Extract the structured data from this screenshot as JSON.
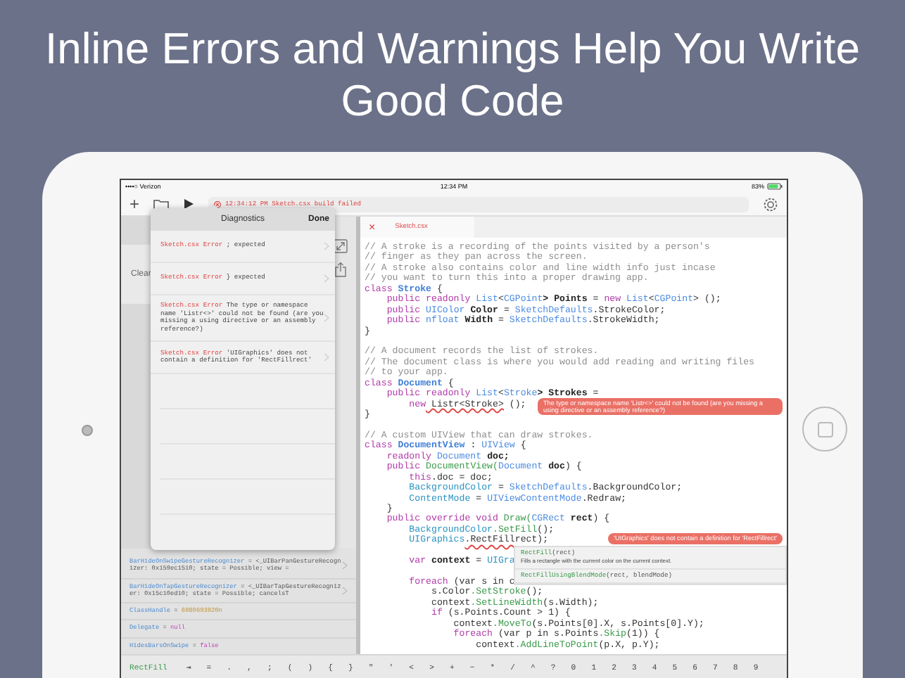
{
  "headline": "Inline Errors and Warnings Help You Write Good Code",
  "status_bar": {
    "carrier": "••••○ Verizon",
    "time": "12:34 PM",
    "battery": "83%"
  },
  "toolbar": {
    "add": "+",
    "build_status": "12:34:12 PM Sketch.csx build failed"
  },
  "left_panel": {
    "clear": "Clear"
  },
  "diagnostics": {
    "title": "Diagnostics",
    "done": "Done",
    "items": [
      {
        "source": "Sketch.csx Error",
        "message": "; expected"
      },
      {
        "source": "Sketch.csx Error",
        "message": "} expected"
      },
      {
        "source": "Sketch.csx Error",
        "message": "The type or namespace name 'Listr<>' could not be found (are you missing a using directive or an assembly reference?)"
      },
      {
        "source": "Sketch.csx Error",
        "message": "'UIGraphics' does not contain a definition for 'RectFillrect'"
      }
    ]
  },
  "debug_items": [
    {
      "name": "BarHideOnSwipeGestureRecognizer",
      "operator": "=",
      "value": "<_UIBarPanGestureRecognizer: 0x159ec1510; state = Possible; view =",
      "kind": "object",
      "expandable": true
    },
    {
      "name": "BarHideOnTapGestureRecognizer",
      "operator": "=",
      "value": "<_UIBarTapGestureRecognizer: 0x15c10ed10; state = Possible; cancelsT",
      "kind": "object",
      "expandable": true
    },
    {
      "name": "ClassHandle",
      "operator": "=",
      "value": "6980693920n",
      "kind": "number",
      "expandable": false
    },
    {
      "name": "Delegate",
      "operator": "=",
      "value": "null",
      "kind": "keyword",
      "expandable": false
    },
    {
      "name": "HidesBarsOnSwipe",
      "operator": "=",
      "value": "false",
      "kind": "keyword",
      "expandable": false
    }
  ],
  "editor": {
    "tab": {
      "close": "×",
      "title": "Sketch.csx"
    },
    "lines": [
      {
        "kind": "code",
        "tokens": [
          {
            "kind": "comment",
            "text": "// A stroke is a recording of the points visited by a person's"
          }
        ]
      },
      {
        "kind": "code",
        "tokens": [
          {
            "kind": "comment",
            "text": "// finger as they pan across the screen."
          }
        ]
      },
      {
        "kind": "code",
        "tokens": [
          {
            "kind": "comment",
            "text": "// A stroke also contains color and line width info just incase"
          }
        ]
      },
      {
        "kind": "code",
        "tokens": [
          {
            "kind": "comment",
            "text": "// you want to turn this into a proper drawing app."
          }
        ]
      },
      {
        "kind": "code",
        "tokens": [
          {
            "kind": "keyword",
            "text": "class"
          },
          {
            "kind": "class",
            "text": " Stroke"
          },
          {
            "kind": "plain",
            "text": " {"
          }
        ]
      },
      {
        "kind": "code",
        "tokens": [
          {
            "kind": "keyword",
            "text": "    public readonly"
          },
          {
            "kind": "type",
            "text": " List"
          },
          {
            "kind": "plain",
            "text": "<"
          },
          {
            "kind": "type",
            "text": "CGPoint"
          },
          {
            "kind": "ident",
            "text": "> Points"
          },
          {
            "kind": "plain",
            "text": " ="
          },
          {
            "kind": "keyword",
            "text": " new"
          },
          {
            "kind": "type",
            "text": " List"
          },
          {
            "kind": "plain",
            "text": "<"
          },
          {
            "kind": "type",
            "text": "CGPoint"
          },
          {
            "kind": "plain",
            "text": "> ();"
          }
        ]
      },
      {
        "kind": "code",
        "tokens": [
          {
            "kind": "keyword",
            "text": "    public"
          },
          {
            "kind": "type",
            "text": " UIColor"
          },
          {
            "kind": "ident",
            "text": " Color"
          },
          {
            "kind": "plain",
            "text": " ="
          },
          {
            "kind": "type",
            "text": " SketchDefaults"
          },
          {
            "kind": "plain",
            "text": ".StrokeColor;"
          }
        ]
      },
      {
        "kind": "code",
        "tokens": [
          {
            "kind": "keyword",
            "text": "    public"
          },
          {
            "kind": "type",
            "text": " nfloat"
          },
          {
            "kind": "ident",
            "text": " Width"
          },
          {
            "kind": "plain",
            "text": " ="
          },
          {
            "kind": "type",
            "text": " SketchDefaults"
          },
          {
            "kind": "plain",
            "text": ".StrokeWidth;"
          }
        ]
      },
      {
        "kind": "code",
        "tokens": [
          {
            "kind": "plain",
            "text": "}"
          }
        ]
      },
      {
        "kind": "blank"
      },
      {
        "kind": "code",
        "tokens": [
          {
            "kind": "comment",
            "text": "// A document records the list of strokes."
          }
        ]
      },
      {
        "kind": "code",
        "tokens": [
          {
            "kind": "comment",
            "text": "// The document class is where you would add reading and writing files"
          }
        ]
      },
      {
        "kind": "code",
        "tokens": [
          {
            "kind": "comment",
            "text": "// to your app."
          }
        ]
      },
      {
        "kind": "code",
        "tokens": [
          {
            "kind": "keyword",
            "text": "class"
          },
          {
            "kind": "class",
            "text": " Document"
          },
          {
            "kind": "plain",
            "text": " {"
          }
        ]
      },
      {
        "kind": "code",
        "tokens": [
          {
            "kind": "keyword",
            "text": "    public readonly"
          },
          {
            "kind": "type",
            "text": " List"
          },
          {
            "kind": "plain",
            "text": "<"
          },
          {
            "kind": "type",
            "text": "Stroke"
          },
          {
            "kind": "ident",
            "text": "> Strokes"
          },
          {
            "kind": "plain",
            "text": " ="
          }
        ]
      },
      {
        "kind": "code",
        "tokens": [
          {
            "kind": "keyword",
            "text": "        new"
          },
          {
            "kind": "error",
            "text": " Listr<Stroke>"
          },
          {
            "kind": "plain",
            "text": " ();"
          }
        ],
        "error": "The type or namespace name 'Listr<>' could not be found (are you missing a using directive or an assembly reference?)"
      },
      {
        "kind": "code",
        "tokens": [
          {
            "kind": "plain",
            "text": "}"
          }
        ]
      },
      {
        "kind": "blank"
      },
      {
        "kind": "code",
        "tokens": [
          {
            "kind": "comment",
            "text": "// A custom UIView that can draw strokes."
          }
        ]
      },
      {
        "kind": "code",
        "tokens": [
          {
            "kind": "keyword",
            "text": "class"
          },
          {
            "kind": "class",
            "text": " DocumentView"
          },
          {
            "kind": "plain",
            "text": " :"
          },
          {
            "kind": "type",
            "text": " UIView"
          },
          {
            "kind": "plain",
            "text": " {"
          }
        ]
      },
      {
        "kind": "code",
        "tokens": [
          {
            "kind": "keyword",
            "text": "    readonly"
          },
          {
            "kind": "type",
            "text": " Document"
          },
          {
            "kind": "ident",
            "text": " doc;"
          }
        ]
      },
      {
        "kind": "code",
        "tokens": [
          {
            "kind": "keyword",
            "text": "    public"
          },
          {
            "kind": "method",
            "text": " DocumentView("
          },
          {
            "kind": "type",
            "text": "Document"
          },
          {
            "kind": "ident",
            "text": " doc"
          },
          {
            "kind": "plain",
            "text": ") {"
          }
        ]
      },
      {
        "kind": "code",
        "tokens": [
          {
            "kind": "keyword",
            "text": "        this"
          },
          {
            "kind": "plain",
            "text": ".doc = doc;"
          }
        ]
      },
      {
        "kind": "code",
        "tokens": [
          {
            "kind": "member",
            "text": "        BackgroundColor"
          },
          {
            "kind": "plain",
            "text": " ="
          },
          {
            "kind": "type",
            "text": " SketchDefaults"
          },
          {
            "kind": "plain",
            "text": ".BackgroundColor;"
          }
        ]
      },
      {
        "kind": "code",
        "tokens": [
          {
            "kind": "member",
            "text": "        ContentMode"
          },
          {
            "kind": "plain",
            "text": " ="
          },
          {
            "kind": "type",
            "text": " UIViewContentMode"
          },
          {
            "kind": "plain",
            "text": ".Redraw;"
          }
        ]
      },
      {
        "kind": "code",
        "tokens": [
          {
            "kind": "plain",
            "text": "    }"
          }
        ]
      },
      {
        "kind": "code",
        "tokens": [
          {
            "kind": "keyword",
            "text": "    public override void"
          },
          {
            "kind": "method",
            "text": " Draw("
          },
          {
            "kind": "type",
            "text": "CGRect"
          },
          {
            "kind": "ident",
            "text": " rect"
          },
          {
            "kind": "plain",
            "text": ") {"
          }
        ]
      },
      {
        "kind": "code",
        "tokens": [
          {
            "kind": "member",
            "text": "        BackgroundColor"
          },
          {
            "kind": "method",
            "text": ".SetFill"
          },
          {
            "kind": "plain",
            "text": "();"
          }
        ]
      },
      {
        "kind": "code",
        "tokens": [
          {
            "kind": "member",
            "text": "        UIGraphics"
          },
          {
            "kind": "error",
            "text": ".RectFill"
          },
          {
            "kind": "plain",
            "text": "rect);"
          }
        ],
        "error": "'UIGraphics' does not contain a definition for 'RectFillrect'",
        "completions": [
          {
            "name": "RectFill",
            "args": "(rect)",
            "description": "Fills a rectangle with the current color on the current context."
          },
          {
            "name": "RectFillUsingBlendMode",
            "args": "(rect, blendMode)"
          }
        ]
      },
      {
        "kind": "blank"
      },
      {
        "kind": "code",
        "tokens": [
          {
            "kind": "keyword",
            "text": "        var"
          },
          {
            "kind": "ident",
            "text": " context"
          },
          {
            "kind": "plain",
            "text": " ="
          },
          {
            "kind": "member",
            "text": " UIGra"
          }
        ]
      },
      {
        "kind": "blank"
      },
      {
        "kind": "code",
        "tokens": [
          {
            "kind": "keyword",
            "text": "        foreach"
          },
          {
            "kind": "plain",
            "text": " (var s in c"
          }
        ]
      },
      {
        "kind": "code",
        "tokens": [
          {
            "kind": "plain",
            "text": "            s.Color"
          },
          {
            "kind": "method",
            "text": ".SetStroke"
          },
          {
            "kind": "plain",
            "text": "();"
          }
        ]
      },
      {
        "kind": "code",
        "tokens": [
          {
            "kind": "plain",
            "text": "            context"
          },
          {
            "kind": "method",
            "text": ".SetLineWidth"
          },
          {
            "kind": "plain",
            "text": "(s.Width);"
          }
        ]
      },
      {
        "kind": "code",
        "tokens": [
          {
            "kind": "keyword",
            "text": "            if"
          },
          {
            "kind": "plain",
            "text": " (s.Points.Count > 1) {"
          }
        ]
      },
      {
        "kind": "code",
        "tokens": [
          {
            "kind": "plain",
            "text": "                context"
          },
          {
            "kind": "method",
            "text": ".MoveTo"
          },
          {
            "kind": "plain",
            "text": "(s.Points[0].X, s.Points[0].Y);"
          }
        ]
      },
      {
        "kind": "code",
        "tokens": [
          {
            "kind": "keyword",
            "text": "                foreach"
          },
          {
            "kind": "plain",
            "text": " (var p in s.Points"
          },
          {
            "kind": "method",
            "text": ".Skip"
          },
          {
            "kind": "plain",
            "text": "(1)) {"
          }
        ]
      },
      {
        "kind": "code",
        "tokens": [
          {
            "kind": "plain",
            "text": "                    context"
          },
          {
            "kind": "method",
            "text": ".AddLineToPoint"
          },
          {
            "kind": "plain",
            "text": "(p.X, p.Y);"
          }
        ]
      }
    ]
  },
  "accessory_bar": {
    "suggestion": "RectFill",
    "keys": [
      "⇥",
      "=",
      ".",
      ",",
      ";",
      "(",
      ")",
      "{",
      "}",
      "\"",
      "'",
      "<",
      ">",
      "+",
      "−",
      "*",
      "/",
      "^",
      "?",
      "0",
      "1",
      "2",
      "3",
      "4",
      "5",
      "6",
      "7",
      "8",
      "9"
    ]
  }
}
